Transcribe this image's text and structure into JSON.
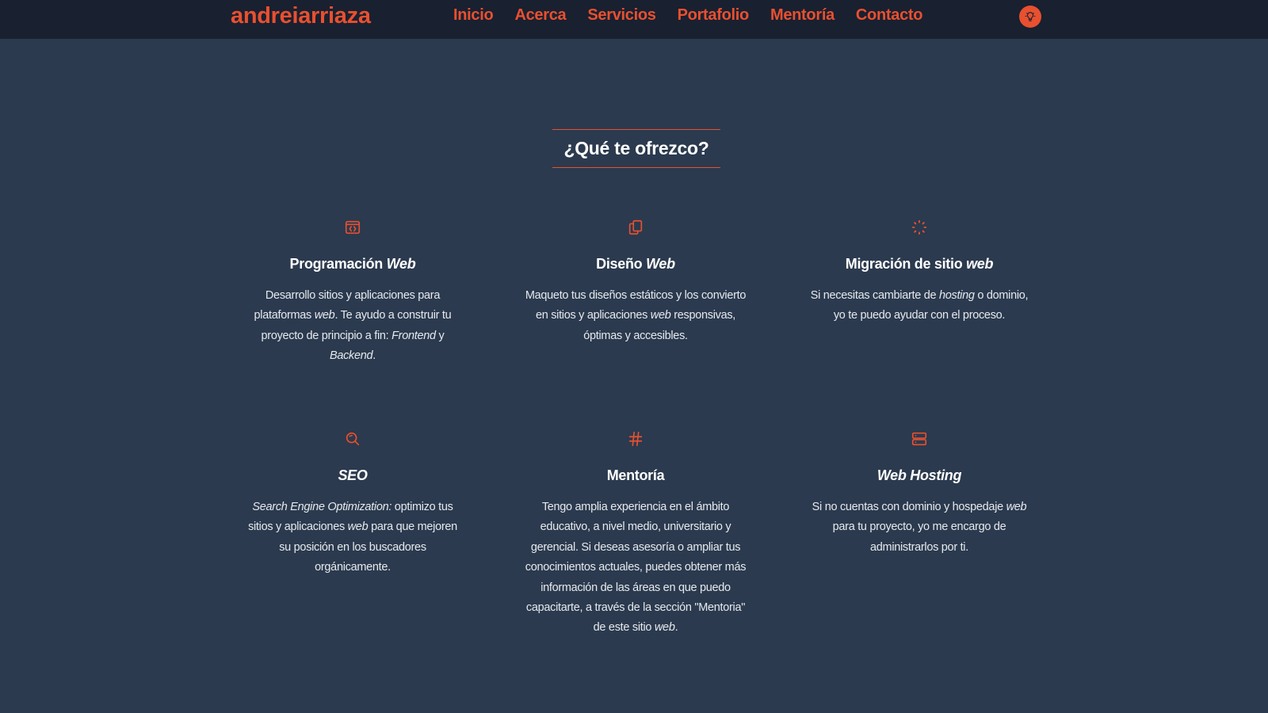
{
  "brand": "andreiarriaza",
  "nav": [
    {
      "label": "Inicio"
    },
    {
      "label": "Acerca"
    },
    {
      "label": "Servicios"
    },
    {
      "label": "Portafolio"
    },
    {
      "label": "Mentoría"
    },
    {
      "label": "Contacto"
    }
  ],
  "theme_toggle_icon": "lightbulb-icon",
  "section_title": "¿Qué te ofrezco?",
  "colors": {
    "accent": "#e8502f",
    "background": "#2b3a4e",
    "navbar": "#192030"
  },
  "services": [
    {
      "icon": "code-window-icon",
      "title_plain": "Programación ",
      "title_em": "Web",
      "desc": {
        "t1": "Desarrollo sitios y aplicaciones para plataformas ",
        "e1": "web",
        "t2": ". Te ayudo a construir tu proyecto de principio a fin: ",
        "e2": "Frontend",
        "t3": " y ",
        "e3": "Backend",
        "t4": "."
      }
    },
    {
      "icon": "copy-icon",
      "title_plain": "Diseño ",
      "title_em": "Web",
      "desc": {
        "t1": "Maqueto tus diseños estáticos y los convierto en sitios y aplicaciones ",
        "e1": "web",
        "t2": " responsivas, óptimas y accesibles."
      }
    },
    {
      "icon": "loader-icon",
      "title_plain": "Migración de sitio ",
      "title_em": "web",
      "desc": {
        "t1": "Si necesitas cambiarte de ",
        "e1": "hosting",
        "t2": " o dominio, yo te puedo ayudar con el proceso."
      }
    },
    {
      "icon": "zoom-icon",
      "title_em": "SEO",
      "desc": {
        "e1": "Search Engine Optimization:",
        "t1": " optimizo tus sitios y aplicaciones ",
        "e2": "web",
        "t2": " para que mejoren su posición en los buscadores orgánicamente."
      }
    },
    {
      "icon": "hash-icon",
      "title_plain": "Mentoría",
      "desc": {
        "t1": "Tengo amplia experiencia en el ámbito educativo, a nivel medio, universitario y gerencial. Si deseas asesoría o ampliar tus conocimientos actuales, puedes obtener más información de las áreas en que puedo capacitarte, a través de la sección \"Mentoria\" de este sitio ",
        "e1": "web",
        "t2": "."
      }
    },
    {
      "icon": "server-icon",
      "title_em": "Web Hosting",
      "desc": {
        "t1": "Si no cuentas con dominio y hospedaje ",
        "e1": "web",
        "t2": " para tu proyecto, yo me encargo de administrarlos por ti."
      }
    }
  ]
}
